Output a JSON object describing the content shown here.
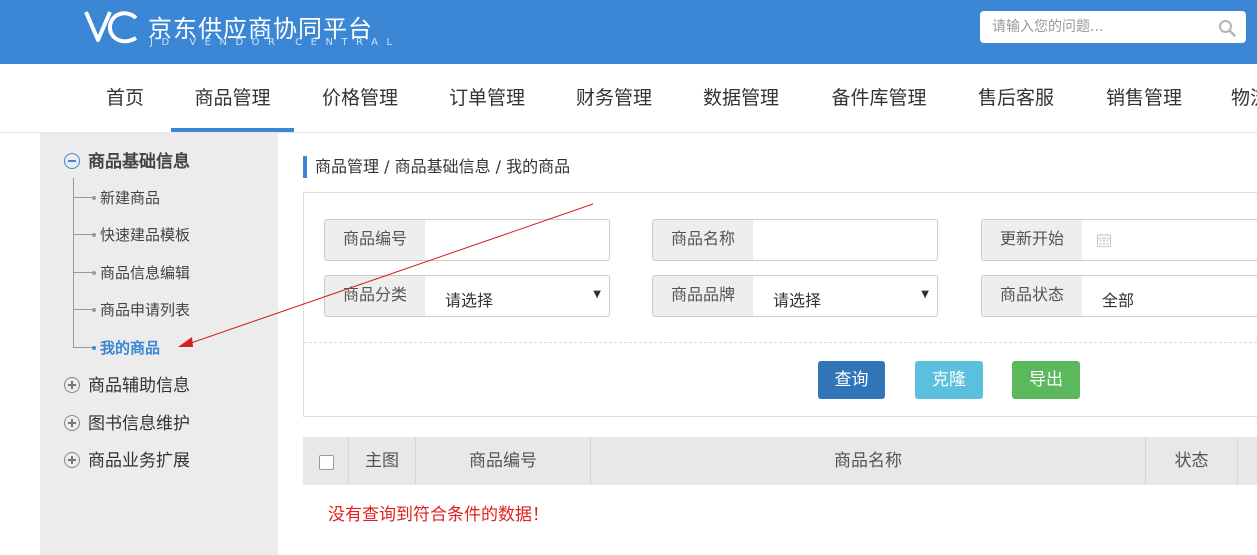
{
  "header": {
    "logo_mark": "VC",
    "title": "京东供应商协同平台",
    "subtitle": "JD VENDOR CENTRAL",
    "search_placeholder": "请输入您的问题...",
    "brand_color": "#3c86d6",
    "search_icon": "search-icon"
  },
  "nav": {
    "items": [
      {
        "label": "首页"
      },
      {
        "label": "商品管理",
        "active": true
      },
      {
        "label": "价格管理"
      },
      {
        "label": "订单管理"
      },
      {
        "label": "财务管理"
      },
      {
        "label": "数据管理"
      },
      {
        "label": "备件库管理"
      },
      {
        "label": "售后客服"
      },
      {
        "label": "销售管理"
      },
      {
        "label": "物流"
      }
    ]
  },
  "sidebar": {
    "groups": [
      {
        "label": "商品基础信息",
        "expanded": true,
        "items": [
          {
            "label": "新建商品"
          },
          {
            "label": "快速建品模板"
          },
          {
            "label": "商品信息编辑"
          },
          {
            "label": "商品申请列表"
          },
          {
            "label": "我的商品",
            "active": true
          }
        ]
      },
      {
        "label": "商品辅助信息",
        "expanded": false
      },
      {
        "label": "图书信息维护",
        "expanded": false
      },
      {
        "label": "商品业务扩展",
        "expanded": false
      }
    ]
  },
  "breadcrumb": "商品管理 / 商品基础信息 / 我的商品",
  "filters": {
    "product_code": {
      "label": "商品编号",
      "value": ""
    },
    "product_name": {
      "label": "商品名称",
      "value": ""
    },
    "update_start": {
      "label": "更新开始",
      "value": "",
      "icon": "calendar-icon"
    },
    "category": {
      "label": "商品分类",
      "value": "请选择"
    },
    "brand": {
      "label": "商品品牌",
      "value": "请选择"
    },
    "status": {
      "label": "商品状态",
      "value": "全部"
    }
  },
  "actions": {
    "query": {
      "label": "查询",
      "color": "#3174b8"
    },
    "clone": {
      "label": "克隆",
      "color": "#5bc0de"
    },
    "export": {
      "label": "导出",
      "color": "#5cb85c"
    }
  },
  "table": {
    "columns": [
      "主图",
      "商品编号",
      "商品名称",
      "状态"
    ],
    "empty_message": "没有查询到符合条件的数据！"
  }
}
